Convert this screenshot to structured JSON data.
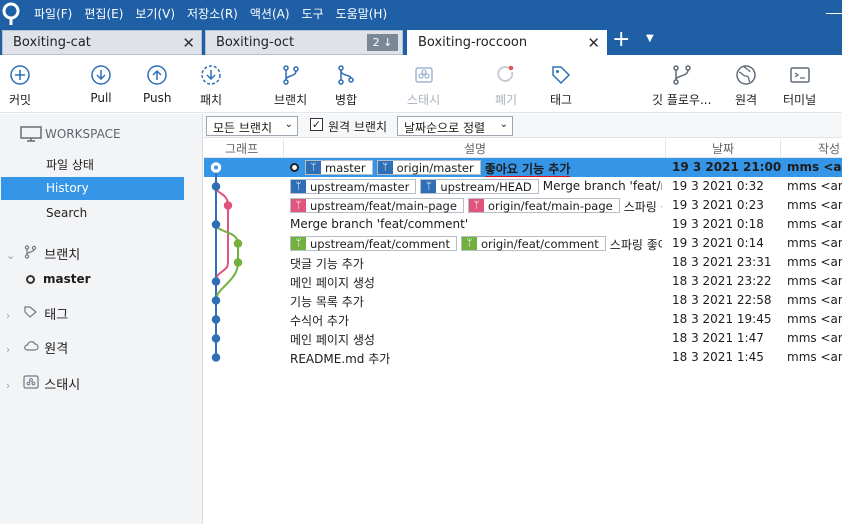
{
  "menu": [
    "파일(F)",
    "편집(E)",
    "보기(V)",
    "저장소(R)",
    "액션(A)",
    "도구",
    "도움말(H)"
  ],
  "tabs": [
    {
      "label": "Boxiting-cat"
    },
    {
      "label": "Boxiting-oct",
      "badge": "2 ↓"
    },
    {
      "label": "Boxiting-roccoon"
    }
  ],
  "toolbar": {
    "commit": "커밋",
    "pull": "Pull",
    "push": "Push",
    "fetch": "패치",
    "branch": "브랜치",
    "merge": "병합",
    "stash": "스태시",
    "discard": "폐기",
    "tag": "태그",
    "gitflow": "깃 플로우...",
    "remote": "원격",
    "terminal": "터미널"
  },
  "sidebar": {
    "workspace": "WORKSPACE",
    "items": [
      {
        "label": "파일 상태"
      },
      {
        "label": "History"
      },
      {
        "label": "Search"
      }
    ],
    "sections": {
      "branches": "브랜치",
      "current_branch": "master",
      "tags": "태그",
      "remotes": "원격",
      "stashes": "스태시"
    }
  },
  "filter": {
    "branches": "모든 브랜치",
    "remote_checkbox": "원격 브랜치",
    "remote_checked": true,
    "sort": "날짜순으로 정렬"
  },
  "columns": {
    "graph": "그래프",
    "description": "설명",
    "date": "날짜",
    "author": "작성"
  },
  "commits": [
    {
      "refs": [
        {
          "name": "master",
          "color": "blue"
        },
        {
          "name": "origin/master",
          "color": "blue"
        }
      ],
      "message": "좋아요 기능 추가",
      "date": "19 3 2021 21:00",
      "author": "mms <ans",
      "selected": true
    },
    {
      "refs": [
        {
          "name": "upstream/master",
          "color": "blue"
        },
        {
          "name": "upstream/HEAD",
          "color": "blue"
        }
      ],
      "message": "Merge branch 'feat/m",
      "date": "19 3 2021 0:32",
      "author": "mms <ans"
    },
    {
      "refs": [
        {
          "name": "upstream/feat/main-page",
          "color": "pink"
        },
        {
          "name": "origin/feat/main-page",
          "color": "pink"
        }
      ],
      "message": "스파링 싱",
      "date": "19 3 2021 0:23",
      "author": "mms <ans"
    },
    {
      "refs": [],
      "message": "Merge branch 'feat/comment'",
      "date": "19 3 2021 0:18",
      "author": "mms <ans"
    },
    {
      "refs": [
        {
          "name": "upstream/feat/comment",
          "color": "green"
        },
        {
          "name": "origin/feat/comment",
          "color": "green"
        }
      ],
      "message": "스파링 좋아",
      "date": "19 3 2021 0:14",
      "author": "mms <ans"
    },
    {
      "refs": [],
      "message": "댓글 기능 추가",
      "date": "18 3 2021 23:31",
      "author": "mms <ans"
    },
    {
      "refs": [],
      "message": "메인 페이지 생성",
      "date": "18 3 2021 23:22",
      "author": "mms <ans"
    },
    {
      "refs": [],
      "message": "기능 목록 추가",
      "date": "18 3 2021 22:58",
      "author": "mms <ans"
    },
    {
      "refs": [],
      "message": "수식어 추가",
      "date": "18 3 2021 19:45",
      "author": "mms <ans"
    },
    {
      "refs": [],
      "message": "메인 페이지 생성",
      "date": "18 3 2021 1:47",
      "author": "mms <ans"
    },
    {
      "refs": [],
      "message": "README.md 추가",
      "date": "18 3 2021 1:45",
      "author": "mms <ans"
    }
  ],
  "colors": {
    "menubar": "#1e5fa6",
    "selection": "#3596e8",
    "graph_blue": "#2f6fb5",
    "graph_pink": "#e0557b",
    "graph_green": "#72b13e"
  }
}
